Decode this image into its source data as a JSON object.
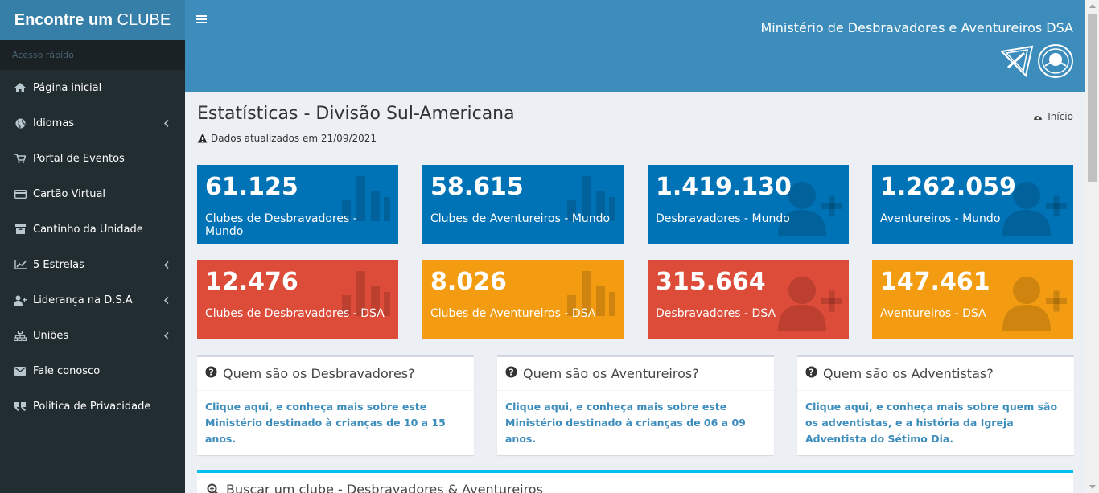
{
  "sidebar": {
    "logo_bold": "Encontre um",
    "logo_light": "CLUBE",
    "header": "Acesso rápido",
    "items": [
      {
        "label": "Página inicial",
        "icon": "home-icon",
        "has_children": false
      },
      {
        "label": "Idiomas",
        "icon": "globe-icon",
        "has_children": true
      },
      {
        "label": "Portal de Eventos",
        "icon": "cart-icon",
        "has_children": false
      },
      {
        "label": "Cartão Virtual",
        "icon": "credit-card-icon",
        "has_children": false
      },
      {
        "label": "Cantinho da Unidade",
        "icon": "archive-icon",
        "has_children": false
      },
      {
        "label": "5 Estrelas",
        "icon": "line-chart-icon",
        "has_children": true
      },
      {
        "label": "Liderança na D.S.A",
        "icon": "user-plus-icon",
        "has_children": true
      },
      {
        "label": "Uniões",
        "icon": "sitemap-icon",
        "has_children": true
      },
      {
        "label": "Fale conosco",
        "icon": "envelope-icon",
        "has_children": false
      },
      {
        "label": "Politica de Privacidade",
        "icon": "quote-icon",
        "has_children": false
      }
    ]
  },
  "header": {
    "site_name": "Ministério de Desbravadores e Aventureiros DSA"
  },
  "page": {
    "title": "Estatísticas - Divisão Sul-Americana",
    "breadcrumb": "Início",
    "updated": "Dados atualizados em 21/09/2021"
  },
  "stats": [
    {
      "value": "61.125",
      "label": "Clubes de Desbravadores - Mundo",
      "color": "#0073b7",
      "icon": "bar-chart-icon"
    },
    {
      "value": "58.615",
      "label": "Clubes de Aventureiros - Mundo",
      "color": "#0073b7",
      "icon": "bar-chart-icon"
    },
    {
      "value": "1.419.130",
      "label": "Desbravadores - Mundo",
      "color": "#0073b7",
      "icon": "user-plus-icon"
    },
    {
      "value": "1.262.059",
      "label": "Aventureiros - Mundo",
      "color": "#0073b7",
      "icon": "user-plus-icon"
    },
    {
      "value": "12.476",
      "label": "Clubes de Desbravadores - DSA",
      "color": "#dd4b39",
      "icon": "bar-chart-icon"
    },
    {
      "value": "8.026",
      "label": "Clubes de Aventureiros - DSA",
      "color": "#f39c12",
      "icon": "bar-chart-icon"
    },
    {
      "value": "315.664",
      "label": "Desbravadores - DSA",
      "color": "#dd4b39",
      "icon": "user-plus-icon"
    },
    {
      "value": "147.461",
      "label": "Aventureiros - DSA",
      "color": "#f39c12",
      "icon": "user-plus-icon"
    }
  ],
  "info_boxes": [
    {
      "title": "Quem são os Desbravadores?",
      "text": "Clique aqui, e conheça mais sobre este Ministério destinado à crianças de 10 a 15 anos."
    },
    {
      "title": "Quem são os Aventureiros?",
      "text": "Clique aqui, e conheça mais sobre este Ministério destinado à crianças de 06 a 09 anos."
    },
    {
      "title": "Quem são os Adventistas?",
      "text": "Clique aqui, e conheça mais sobre quem são os adventistas, e a história da Igreja Adventista do Sétimo Dia."
    }
  ],
  "search": {
    "title": "Buscar um clube - Desbravadores & Aventureiros"
  }
}
